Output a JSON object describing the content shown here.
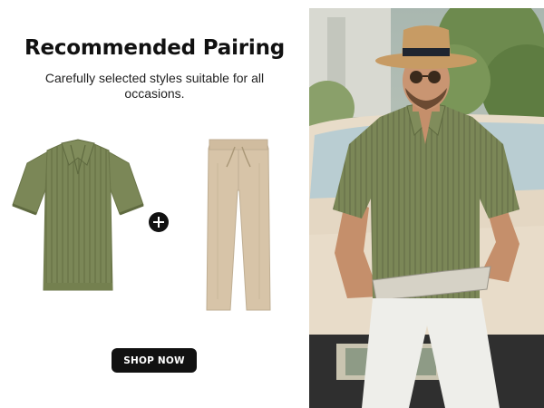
{
  "banner": {
    "title": "Recommended Pairing",
    "subtitle": "Carefully selected styles suitable for all occasions.",
    "cta_label": "SHOP NOW",
    "plus_icon": "plus-circle-icon"
  },
  "products": [
    {
      "name": "green-knit-polo-shirt",
      "color": "#7b8757"
    },
    {
      "name": "khaki-drawstring-pants",
      "color": "#d7c4a8"
    }
  ],
  "model_photo": {
    "shirt_color": "#7b8757",
    "pants_color": "#eeeeea",
    "hat_color": "#c79b64"
  },
  "colors": {
    "text": "#111111",
    "button_bg": "#111111",
    "button_text": "#ffffff",
    "background": "#ffffff"
  }
}
